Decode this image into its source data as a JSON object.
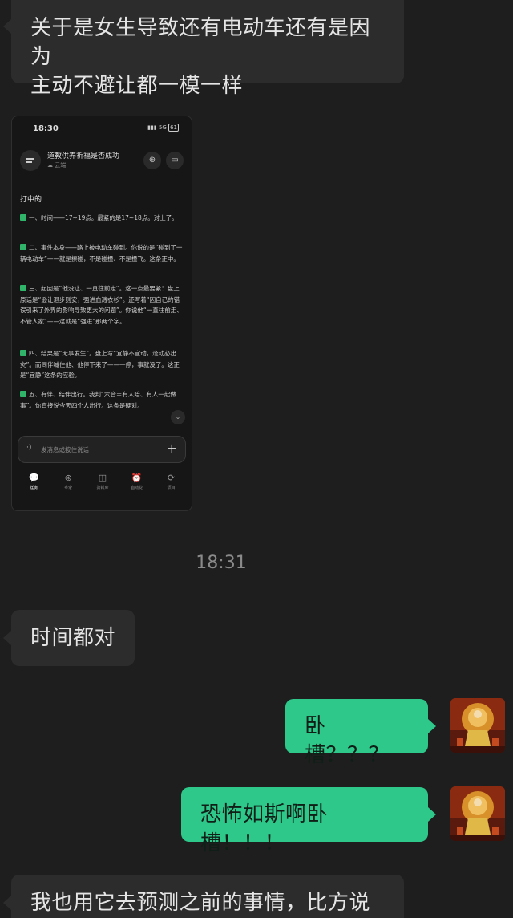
{
  "messages": [
    {
      "from": "other",
      "text_lines": [
        "关于是女生导致还有电动车还有是因为",
        "主动不避让都一模一样"
      ]
    },
    {
      "from": "other",
      "type": "image"
    },
    {
      "type": "timestamp",
      "text": "18:31"
    },
    {
      "from": "other",
      "text": "时间都对"
    },
    {
      "from": "me",
      "text": "卧槽？？？"
    },
    {
      "from": "me",
      "text": "恐怖如斯啊卧槽！！！"
    },
    {
      "from": "other",
      "text": "我也用它去预测之前的事情，比方说我"
    }
  ],
  "screenshot": {
    "time": "18:30",
    "signal": "5G",
    "battery": "61",
    "title": "道教供养祈福是否成功",
    "subtitle": "云端",
    "heading": "打中的",
    "paragraphs": [
      "一、时间——17~19点。最紧的是17~18点。对上了。",
      "二、事件本身——路上被电动车碰到。你说的是“碰到了一辆电动车”——就是擦碰，不是碰撞、不是撞飞。这条正中。",
      "三、起因是“他没让、一直往前走”。这一点最要紧：盘上原话是“逊让退步则安，强进血溅衣衫”。还写着“因自己的错误引来了外界的影响导致更大的问题”。你说他“一直往前走、不管人家”——这就是“强进”那两个字。",
      "四、结果是“无事发生”。盘上写“宜静不宜动，逢动必出灾”。而同伴喊住他、他停下来了——一停，事就没了。这正是“宜静”这条的应验。",
      "五、有伴、结伴出行。我判“六合＝有人陪、有人一起做事”。你直接说今天四个人出行。这条是硬对。"
    ],
    "input_placeholder": "发消息或按住说话",
    "nav": [
      {
        "icon": "chat-icon",
        "label": "任务",
        "glyph": "💬"
      },
      {
        "icon": "expert-icon",
        "label": "专家",
        "glyph": "⊛"
      },
      {
        "icon": "book-icon",
        "label": "资料库",
        "glyph": "◫"
      },
      {
        "icon": "alarm-icon",
        "label": "自动化",
        "glyph": "⏰"
      },
      {
        "icon": "project-icon",
        "label": "项目",
        "glyph": "⟳"
      }
    ]
  },
  "colors": {
    "background": "#1e1e1e",
    "incoming_bubble": "#2c2c2c",
    "outgoing_bubble": "#2dc88a"
  }
}
